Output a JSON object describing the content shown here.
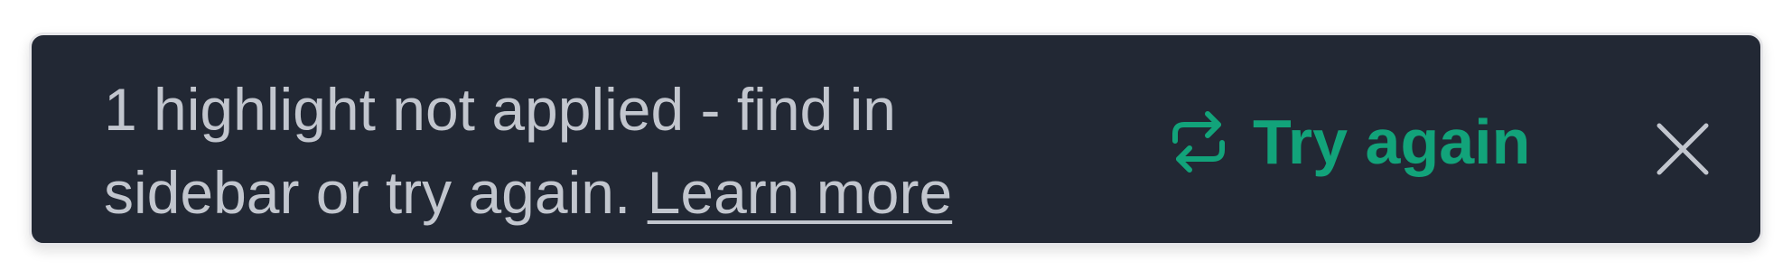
{
  "toast": {
    "message": "1 highlight not applied - find in sidebar or try again.",
    "learn_more_label": "Learn more",
    "retry_label": "Try again",
    "retry_icon": "repeat-arrows-icon",
    "close_icon": "close-icon"
  },
  "colors": {
    "toast_background": "#222834",
    "toast_text": "#c2c6ce",
    "accent": "#12a37a",
    "close_icon": "#c2c6ce"
  }
}
